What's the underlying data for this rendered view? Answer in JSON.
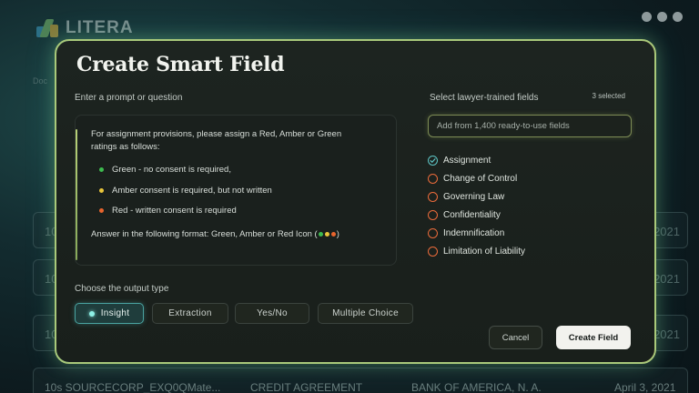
{
  "background": {
    "logo_text": "LITERA",
    "left_label": "Doc",
    "row_number": "10",
    "row_year": "2021",
    "bottom_row": {
      "name": "10s SOURCECORP_EXQ0QMate...",
      "type": "CREDIT AGREEMENT",
      "party": "BANK OF AMERICA, N. A.",
      "date": "April 3, 2021"
    }
  },
  "modal": {
    "title": "Create Smart Field",
    "prompt_section_label": "Enter a prompt or question",
    "prompt": {
      "intro": "For assignment provisions, please assign a Red, Amber or Green ratings as follows:",
      "ratings": [
        {
          "text": "Green - no consent is required,",
          "color": "#3dbb4f"
        },
        {
          "text": "Amber consent is required, but not written",
          "color": "#e9c53b"
        },
        {
          "text": "Red - written consent is required",
          "color": "#e8642d"
        }
      ],
      "format_prefix": "Answer in the following format: Green, Amber or Red Icon (",
      "format_suffix": ")"
    },
    "fields_section_label": "Select lawyer-trained fields",
    "selected_count": "3 selected",
    "search_placeholder": "Add from 1,400 ready-to-use fields",
    "fields": [
      {
        "label": "Assignment",
        "checked": true
      },
      {
        "label": "Change of Control",
        "checked": false
      },
      {
        "label": "Governing Law",
        "checked": false
      },
      {
        "label": "Confidentiality",
        "checked": false
      },
      {
        "label": "Indemnification",
        "checked": false
      },
      {
        "label": "Limitation of Liability",
        "checked": false
      }
    ],
    "output_section_label": "Choose the output type",
    "output_types": [
      "Insight",
      "Extraction",
      "Yes/No",
      "Multiple Choice"
    ],
    "active_output_type": "Insight",
    "cancel_label": "Cancel",
    "create_label": "Create Field"
  },
  "colors": {
    "accent_teal": "#4aa3a0",
    "accent_orange": "#ea6b3b",
    "border_glow": "#a9c97a"
  }
}
